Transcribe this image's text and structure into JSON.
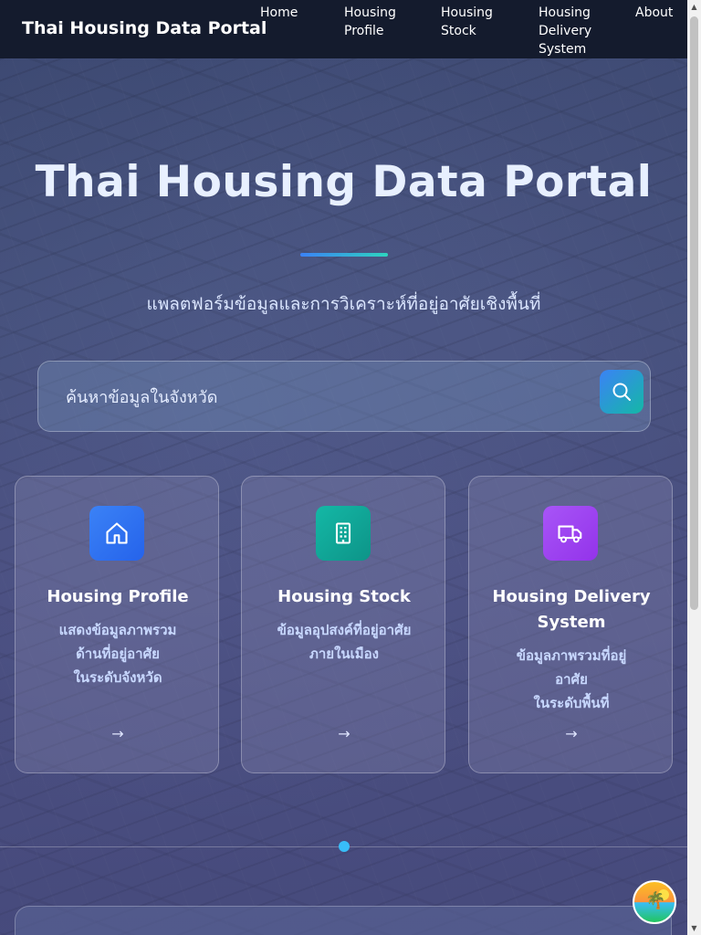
{
  "navbar": {
    "brand": "Thai Housing Data Portal",
    "items": [
      {
        "lines": [
          "Home"
        ]
      },
      {
        "lines": [
          "Housing",
          "Profile"
        ]
      },
      {
        "lines": [
          "Housing",
          "Stock"
        ]
      },
      {
        "lines": [
          "Housing",
          "Delivery",
          "System"
        ]
      },
      {
        "lines": [
          "About"
        ]
      }
    ]
  },
  "hero": {
    "title": "Thai Housing Data Portal",
    "subtitle": "แพลตฟอร์มข้อมูลและการวิเคราะห์ที่อยู่อาศัยเชิงพื้นที่"
  },
  "search": {
    "placeholder": "ค้นหาข้อมูลในจังหวัด",
    "icon": "search-icon"
  },
  "cards": [
    {
      "title_lines": [
        "Housing Profile"
      ],
      "desc_lines": [
        "แสดงข้อมูลภาพรวม",
        "ด้านที่อยู่อาศัย",
        "ในระดับจังหวัด"
      ],
      "icon": "home-icon",
      "color_from": "#3b82f6",
      "color_to": "#2563eb",
      "arrow": "→"
    },
    {
      "title_lines": [
        "Housing Stock"
      ],
      "desc_lines": [
        "ข้อมูลอุปสงค์ที่อยู่อาศัย",
        "ภายในเมือง"
      ],
      "icon": "building-icon",
      "color_from": "#14b8a6",
      "color_to": "#0d9488",
      "arrow": "→"
    },
    {
      "title_lines": [
        "Housing Delivery",
        "System"
      ],
      "desc_lines": [
        "ข้อมูลภาพรวมที่อยู่",
        "อาศัย",
        "ในระดับพื้นที่"
      ],
      "icon": "truck-icon",
      "color_from": "#a855f7",
      "color_to": "#9333ea",
      "arrow": "→"
    }
  ],
  "carousel": {
    "active_index": 0
  },
  "fab": {
    "icon": "beach-chat-icon"
  }
}
